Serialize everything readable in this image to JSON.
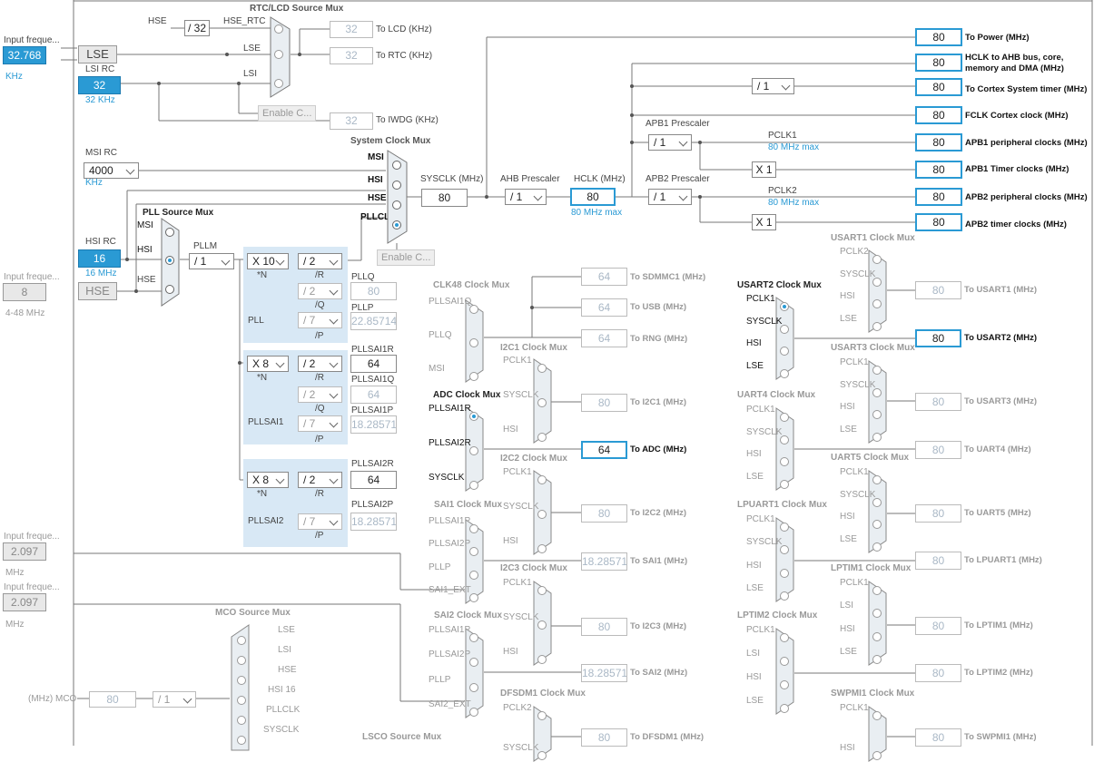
{
  "inputs": {
    "lse_freq_label": "Input freque...",
    "lse_freq": "32.768",
    "lse_unit": "KHz",
    "lse": "LSE",
    "lsi_title": "LSI RC",
    "lsi": "32",
    "lsi_sub": "32 KHz",
    "msi_title": "MSI RC",
    "msi": "4000",
    "msi_unit": "KHz",
    "hsi_title": "HSI RC",
    "hsi": "16",
    "hsi_sub": "16 MHz",
    "hse_freq_label": "Input freque...",
    "hse_freq": "8",
    "hse_range": "4-48 MHz",
    "hse": "HSE",
    "in2_label": "Input freque...",
    "in2": "2.097",
    "in2_unit": "MHz",
    "in3_label": "Input freque...",
    "in3": "2.097",
    "in3_unit": "MHz"
  },
  "rtc": {
    "title": "RTC/LCD Source Mux",
    "hse": "HSE",
    "div32": "/ 32",
    "hse_rtc": "HSE_RTC",
    "lse": "LSE",
    "lsi": "LSI",
    "lcd_val": "32",
    "lcd_label": "To LCD (KHz)",
    "rtc_val": "32",
    "rtc_label": "To RTC (KHz)",
    "enable": "Enable C...",
    "iwdg_val": "32",
    "iwdg_label": "To IWDG (KHz)"
  },
  "sysmux": {
    "title": "System Clock Mux",
    "msi": "MSI",
    "hsi": "HSI",
    "hse": "HSE",
    "pllclk": "PLLCLK",
    "enable": "Enable C...",
    "sysclk_label": "SYSCLK (MHz)",
    "sysclk": "80",
    "ahb_label": "AHB Prescaler",
    "ahb": "/ 1",
    "hclk_label": "HCLK (MHz)",
    "hclk": "80",
    "hclk_max": "80 MHz max",
    "apb1_label": "APB1 Prescaler",
    "apb1": "/ 1",
    "apb2_label": "APB2 Prescaler",
    "apb2": "/ 1",
    "cortex_div": "/ 1",
    "pclk1": "PCLK1",
    "pclk1_max": "80 MHz max",
    "pclk2": "PCLK2",
    "pclk2_max": "80 MHz max",
    "x1a": "X 1",
    "x1b": "X 1"
  },
  "outputs": [
    {
      "value": "80",
      "label": "To Power (MHz)"
    },
    {
      "value": "80",
      "label": "HCLK to AHB bus, core, memory and DMA (MHz)"
    },
    {
      "value": "80",
      "label": "To Cortex System timer (MHz)"
    },
    {
      "value": "80",
      "label": "FCLK Cortex clock (MHz)"
    },
    {
      "value": "80",
      "label": "APB1 peripheral clocks (MHz)"
    },
    {
      "value": "80",
      "label": "APB1 Timer clocks (MHz)"
    },
    {
      "value": "80",
      "label": "APB2 peripheral clocks (MHz)"
    },
    {
      "value": "80",
      "label": "APB2 timer clocks (MHz)"
    }
  ],
  "pll": {
    "src_title": "PLL Source Mux",
    "msi": "MSI",
    "hsi": "HSI",
    "hse": "HSE",
    "pllm_label": "PLLM",
    "pllm": "/ 1",
    "pll_n": "X 10",
    "n": "*N",
    "pll_r": "/ 2",
    "r": "/R",
    "pll_q": "/ 2",
    "q": "/Q",
    "pll_p": "/ 7",
    "p": "/P",
    "name": "PLL",
    "pllq_label": "PLLQ",
    "pllq": "80",
    "pllp_label": "PLLP",
    "pllp": "22.85714",
    "sai1_n": "X 8",
    "sai1_r": "/ 2",
    "sai1_q": "/ 2",
    "sai1_p": "/ 7",
    "sai1_name": "PLLSAI1",
    "sai1r_label": "PLLSAI1R",
    "sai1r": "64",
    "sai1q_label": "PLLSAI1Q",
    "sai1q": "64",
    "sai1p_label": "PLLSAI1P",
    "sai1p": "18.28571",
    "sai2_n": "X 8",
    "sai2_r": "/ 2",
    "sai2_p": "/ 7",
    "sai2_name": "PLLSAI2",
    "sai2r_label": "PLLSAI2R",
    "sai2r": "64",
    "sai2p_label": "PLLSAI2P",
    "sai2p": "18.28571"
  },
  "mid": {
    "clk48_title": "CLK48 Clock Mux",
    "clk48_in": [
      "PLLSAI1Q",
      "PLLQ",
      "MSI"
    ],
    "sdmmc_val": "64",
    "sdmmc": "To SDMMC1 (MHz)",
    "usb_val": "64",
    "usb": "To USB (MHz)",
    "rng_val": "64",
    "rng": "To RNG (MHz)",
    "i2c1_title": "I2C1 Clock Mux",
    "i2c1_in": [
      "PCLK1",
      "SYSCLK",
      "HSI"
    ],
    "i2c1_val": "80",
    "i2c1": "To I2C1 (MHz)",
    "adc_title": "ADC Clock Mux",
    "adc_in": [
      "PLLSAI1R",
      "PLLSAI2R",
      "SYSCLK"
    ],
    "adc_val": "64",
    "adc": "To ADC (MHz)",
    "i2c2_title": "I2C2 Clock Mux",
    "i2c2_in": [
      "PCLK1",
      "SYSCLK",
      "HSI"
    ],
    "i2c2_val": "80",
    "i2c2": "To I2C2 (MHz)",
    "sai1_title": "SAI1 Clock Mux",
    "sai1_in": [
      "PLLSAI1P",
      "PLLSAI2P",
      "PLLP",
      "SAI1_EXT"
    ],
    "sai1_val": "18.28571",
    "sai1": "To SAI1 (MHz)",
    "i2c3_title": "I2C3 Clock Mux",
    "i2c3_in": [
      "PCLK1",
      "SYSCLK",
      "HSI"
    ],
    "i2c3_val": "80",
    "i2c3": "To I2C3 (MHz)",
    "sai2_title": "SAI2 Clock Mux",
    "sai2_in": [
      "PLLSAI1P",
      "PLLSAI2P",
      "PLLP",
      "SAI2_EXT"
    ],
    "sai2_val": "18.28571",
    "sai2": "To SAI2 (MHz)",
    "dfsdm_title": "DFSDM1 Clock Mux",
    "dfsdm_in": [
      "PCLK2",
      "SYSCLK"
    ],
    "dfsdm_val": "80",
    "dfsdm": "To DFSDM1 (MHz)",
    "mco_title": "MCO Source Mux",
    "mco_in": [
      "LSE",
      "LSI",
      "HSE",
      "HSI 16",
      "PLLCLK",
      "SYSCLK"
    ],
    "mco_label": "(MHz) MCO",
    "mco_val": "80",
    "mco_div": "/ 1",
    "lsco_title": "LSCO Source Mux"
  },
  "right": {
    "usart1_title": "USART1 Clock Mux",
    "usart1_in": [
      "PCLK2",
      "SYSCLK",
      "HSI",
      "LSE"
    ],
    "usart1_val": "80",
    "usart1": "To USART1 (MHz)",
    "usart2_title": "USART2 Clock Mux",
    "usart2_in": [
      "PCLK1",
      "SYSCLK",
      "HSI",
      "LSE"
    ],
    "usart2_val": "80",
    "usart2": "To USART2 (MHz)",
    "usart3_title": "USART3 Clock Mux",
    "usart3_in": [
      "PCLK1",
      "SYSCLK",
      "HSI",
      "LSE"
    ],
    "usart3_val": "80",
    "usart3": "To USART3 (MHz)",
    "uart4_title": "UART4 Clock Mux",
    "uart4_in": [
      "PCLK1",
      "SYSCLK",
      "HSI",
      "LSE"
    ],
    "uart4_val": "80",
    "uart4": "To UART4 (MHz)",
    "uart5_title": "UART5 Clock Mux",
    "uart5_in": [
      "PCLK1",
      "SYSCLK",
      "HSI",
      "LSE"
    ],
    "uart5_val": "80",
    "uart5": "To UART5 (MHz)",
    "lpuart1_title": "LPUART1 Clock Mux",
    "lpuart1_in": [
      "PCLK1",
      "SYSCLK",
      "HSI",
      "LSE"
    ],
    "lpuart1_val": "80",
    "lpuart1": "To LPUART1 (MHz)",
    "lptim1_title": "LPTIM1 Clock Mux",
    "lptim1_in": [
      "PCLK1",
      "LSI",
      "HSI",
      "LSE"
    ],
    "lptim1_val": "80",
    "lptim1": "To LPTIM1 (MHz)",
    "lptim2_title": "LPTIM2 Clock Mux",
    "lptim2_in": [
      "PCLK1",
      "LSI",
      "HSI",
      "LSE"
    ],
    "lptim2_val": "80",
    "lptim2": "To LPTIM2 (MHz)",
    "swpmi1_title": "SWPMI1 Clock Mux",
    "swpmi1_in": [
      "PCLK1",
      "HSI"
    ],
    "swpmi1_val": "80",
    "swpmi1": "To SWPMI1 (MHz)"
  },
  "colors": {
    "accent": "#2a9ad4",
    "panel": "#d8e8f5"
  }
}
